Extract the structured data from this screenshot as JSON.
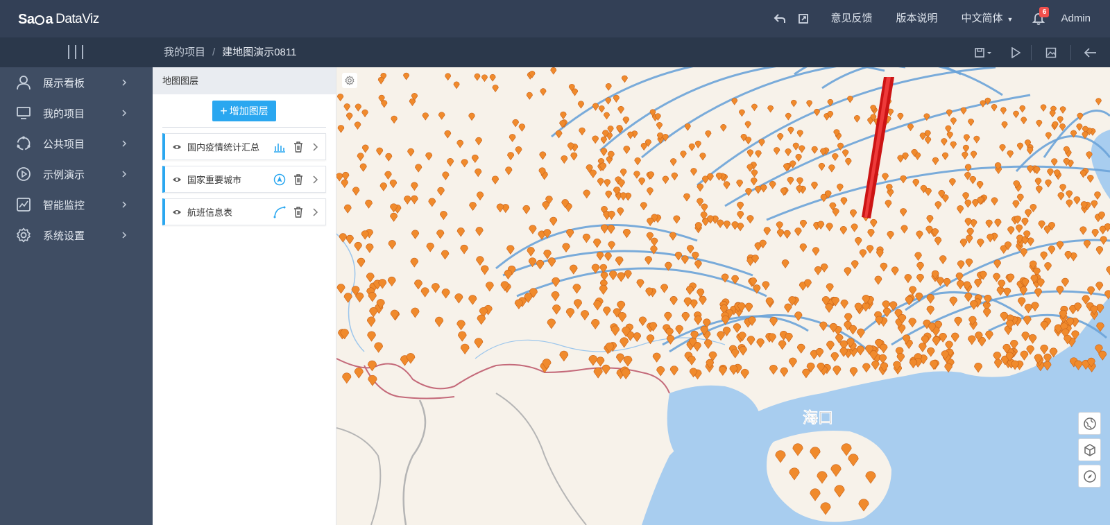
{
  "header": {
    "logo_text": "SaGa DataViz",
    "links": [
      "意见反馈",
      "版本说明"
    ],
    "language": "中文简体",
    "notification_count": "6",
    "user": "Admin",
    "icons": [
      "undo-icon",
      "external-link-icon",
      "bell-icon"
    ]
  },
  "subbar": {
    "breadcrumb": [
      "我的项目",
      "建地图演示0811"
    ],
    "tools": [
      "save-icon",
      "play-icon",
      "image-icon",
      "back-arrow-icon"
    ]
  },
  "sidebar": {
    "items": [
      {
        "label": "展示看板",
        "icon": "user-icon"
      },
      {
        "label": "我的项目",
        "icon": "monitor-icon"
      },
      {
        "label": "公共项目",
        "icon": "circle-dots-icon"
      },
      {
        "label": "示例演示",
        "icon": "play-circle-icon"
      },
      {
        "label": "智能监控",
        "icon": "chart-line-icon"
      },
      {
        "label": "系统设置",
        "icon": "gear-icon"
      }
    ]
  },
  "panel": {
    "title": "地图图层",
    "add_button": "增加图层",
    "layers": [
      {
        "name": "国内疫情统计汇总",
        "type_icon": "bar-chart-icon"
      },
      {
        "name": "国家重要城市",
        "type_icon": "location-icon"
      },
      {
        "name": "航班信息表",
        "type_icon": "arc-line-icon"
      }
    ]
  },
  "map": {
    "label": "海口",
    "controls": [
      "globe-icon",
      "cube-icon",
      "compass-icon"
    ],
    "colors": {
      "sea": "#a8cdef",
      "land": "#f7f2ea",
      "marker": "#f08a2c",
      "flight_line": "#6aa3d8",
      "bar": "#d81e1e"
    }
  }
}
